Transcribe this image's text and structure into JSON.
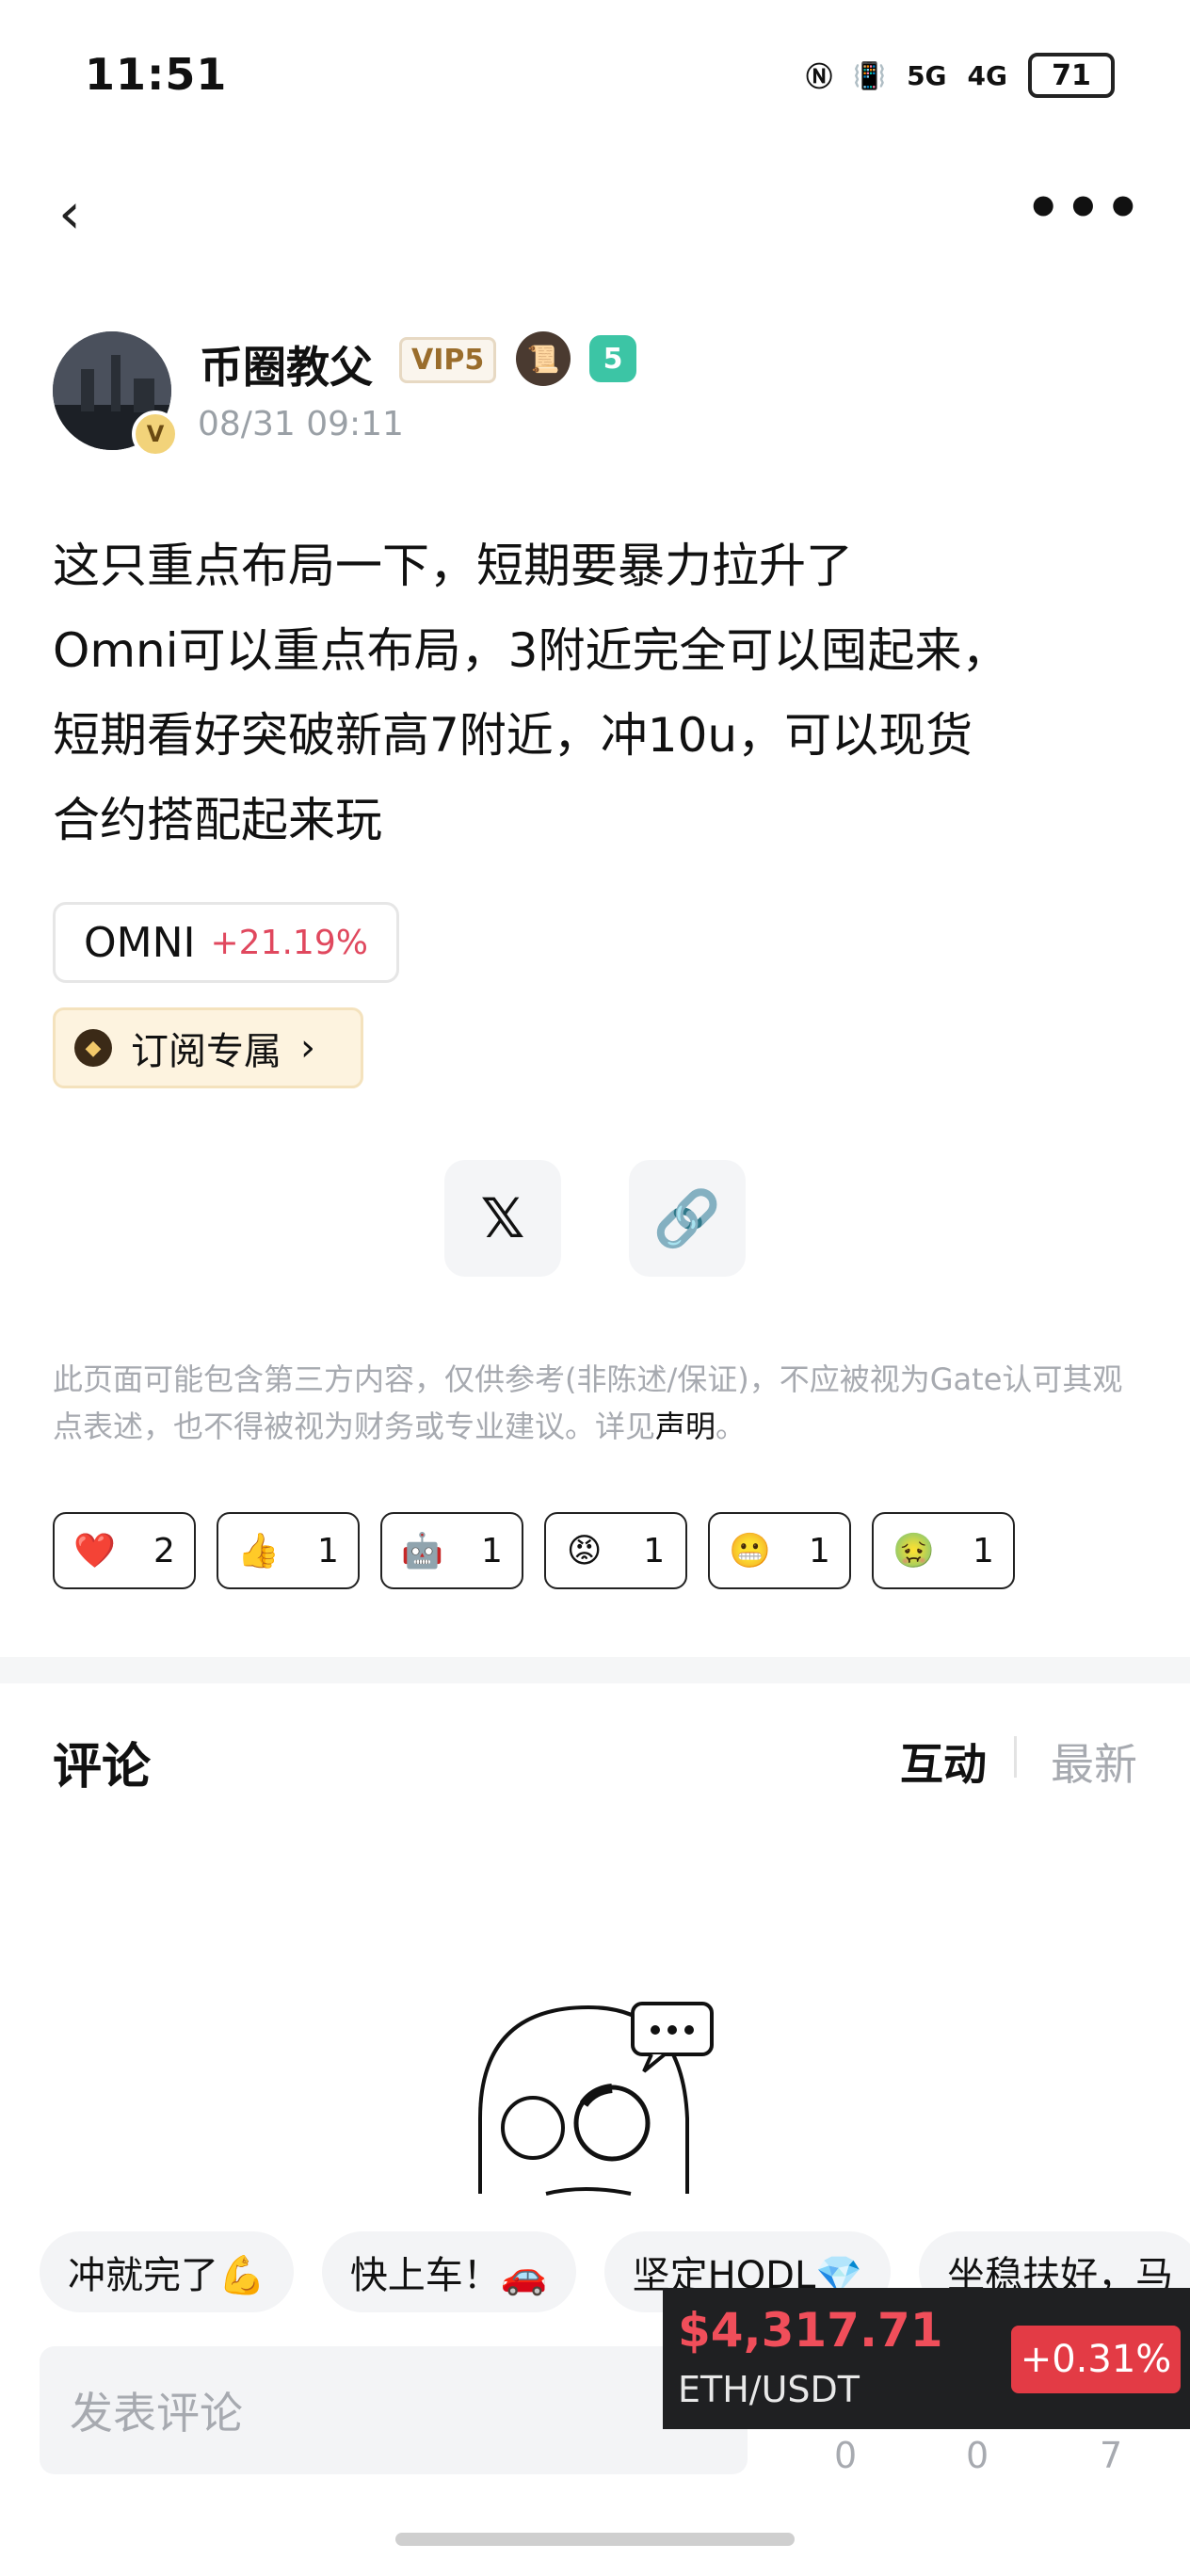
{
  "status_bar": {
    "time": "11:51",
    "battery": "71",
    "net1": "5G",
    "net2": "4G"
  },
  "post": {
    "username": "币圈教父",
    "vip_label": "VIP5",
    "level": "5",
    "timestamp": "08/31 09:11",
    "content_lines": [
      "这只重点布局一下，短期要暴力拉升了",
      "Omni可以重点布局，3附近完全可以囤起来，",
      "短期看好突破新高7附近，冲10u，可以现货",
      "合约搭配起来玩"
    ],
    "coin_tag": {
      "name": "OMNI",
      "change": "+21.19%"
    },
    "subscribe_label": "订阅专属"
  },
  "share": {
    "x_icon": "𝕏",
    "link_icon": "🔗"
  },
  "disclaimer": {
    "text": "此页面可能包含第三方内容，仅供参考(非陈述/保证)，不应被视为Gate认可其观点表述，也不得被视为财务或专业建议。详见",
    "link": "声明",
    "end": "。"
  },
  "reactions": [
    {
      "emoji": "❤️",
      "count": "2"
    },
    {
      "emoji": "👍",
      "count": "1"
    },
    {
      "emoji": "🤖",
      "count": "1"
    },
    {
      "emoji": "😡",
      "count": "1"
    },
    {
      "emoji": "😬",
      "count": "1"
    },
    {
      "emoji": "🤢",
      "count": "1"
    }
  ],
  "comments": {
    "title": "评论",
    "tab_active": "互动",
    "tab_inactive": "最新"
  },
  "quick_replies": [
    "冲就完了💪",
    "快上车！🚗",
    "坚定HODL💎",
    "坐稳扶好，马"
  ],
  "comment_input": {
    "placeholder": "发表评论"
  },
  "counts": [
    "0",
    "0",
    "7"
  ],
  "ticker": {
    "price": "$4,317.71",
    "pair": "ETH/USDT",
    "change": "+0.31%"
  }
}
